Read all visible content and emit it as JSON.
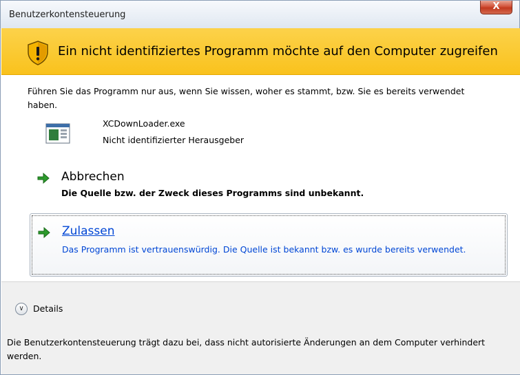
{
  "window": {
    "title": "Benutzerkontensteuerung",
    "close_label": "X"
  },
  "banner": {
    "icon": "uac-shield-icon",
    "message": "Ein nicht identifiziertes Programm möchte auf den Computer zugreifen",
    "color": "#fcca2e"
  },
  "intro": {
    "text": "Führen Sie das Programm nur aus, wenn Sie wissen, woher es stammt, bzw. Sie es bereits verwendet haben."
  },
  "program": {
    "icon": "application-icon",
    "name": "XCDownLoader.exe",
    "publisher": "Nicht identifizierter Herausgeber"
  },
  "options": {
    "cancel": {
      "icon": "green-arrow-icon",
      "title": "Abbrechen",
      "description": "Die Quelle bzw. der Zweck dieses Programms sind unbekannt."
    },
    "allow": {
      "icon": "green-arrow-icon",
      "title": "Zulassen",
      "description": "Das Programm ist vertrauenswürdig. Die Quelle ist bekannt bzw. es wurde bereits verwendet.",
      "link_color": "#0046d5"
    }
  },
  "details": {
    "icon": "chevron-down-circle-icon",
    "label": "Details"
  },
  "footer": {
    "text": "Die Benutzerkontensteuerung trägt dazu bei, dass nicht autorisierte Änderungen an dem Computer verhindert werden."
  }
}
